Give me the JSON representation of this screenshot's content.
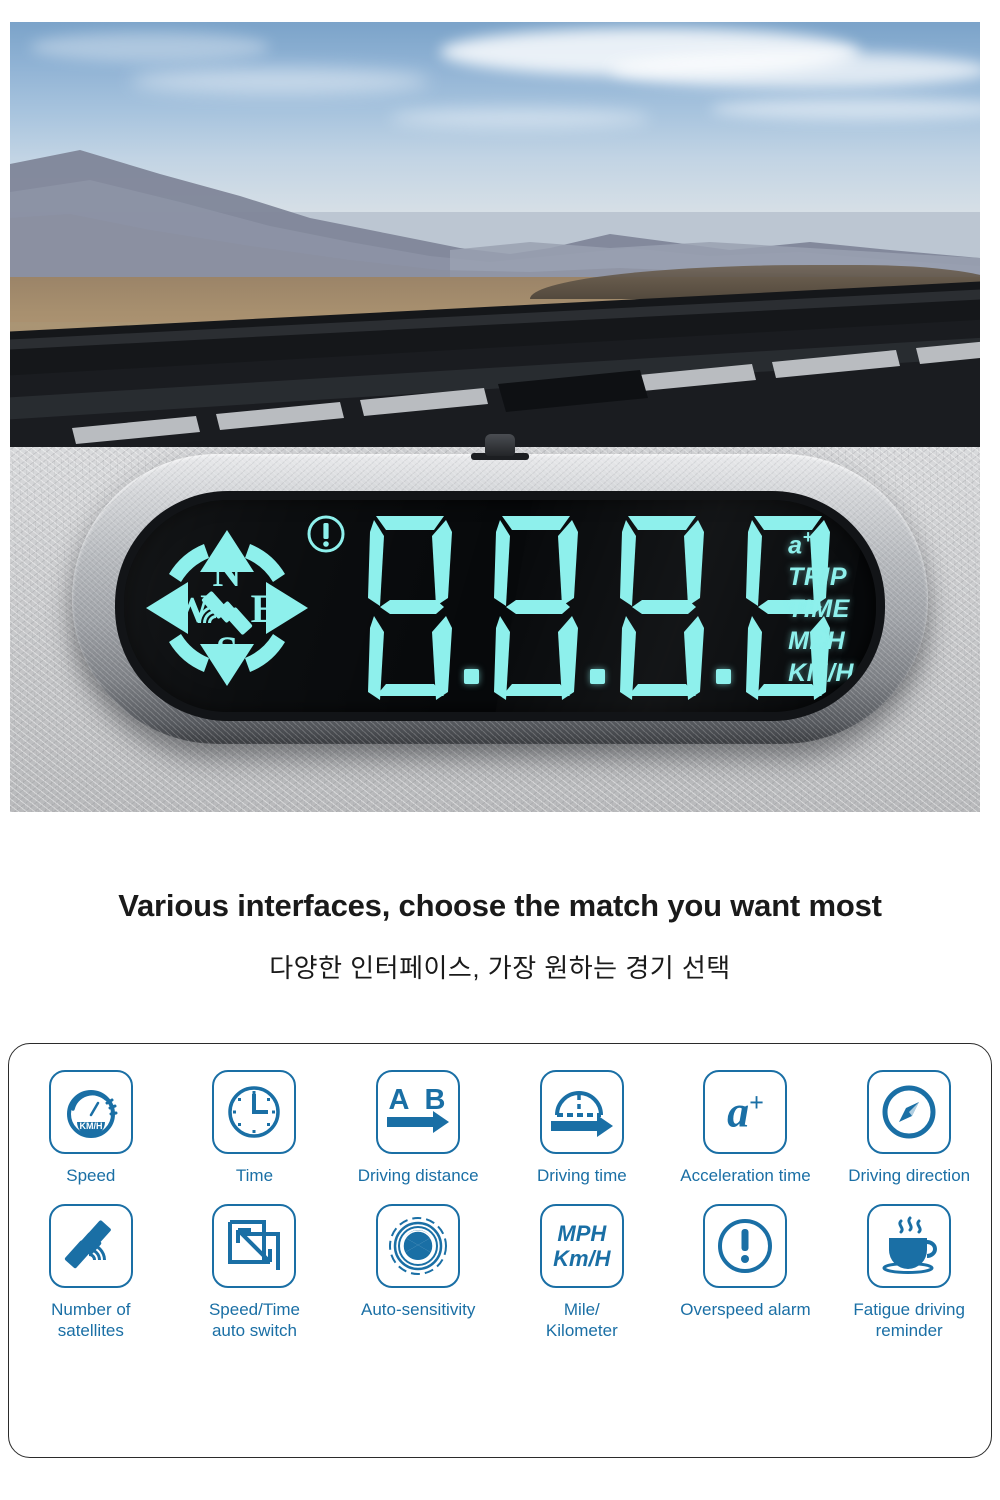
{
  "hero": {
    "scene_description": "Desert highway viewed through car windshield with HUD device on dashboard",
    "device": {
      "display": {
        "digits": [
          "8",
          "8",
          "8",
          "8"
        ],
        "separator": ".",
        "compass": {
          "north": "N",
          "west": "W",
          "east": "E",
          "south": "S",
          "center_icon": "satellite-icon"
        },
        "warning_icon": "exclamation-circle-icon",
        "units": [
          {
            "id": "accel",
            "label": "a",
            "sup": "+"
          },
          {
            "id": "trip",
            "label": "TRIP"
          },
          {
            "id": "time",
            "label": "TIME"
          },
          {
            "id": "mph",
            "label": "MPH"
          },
          {
            "id": "kmh",
            "label": "KM/H"
          }
        ]
      }
    }
  },
  "headings": {
    "title": "Various interfaces, choose the match you want most",
    "subtitle": "다양한 인터페이스, 가장 원하는 경기 선택"
  },
  "features": [
    {
      "icon": "speedometer-icon",
      "label": "Speed",
      "inner_text": "KM/H"
    },
    {
      "icon": "clock-icon",
      "label": "Time"
    },
    {
      "icon": "a-to-b-arrow-icon",
      "label": "Driving distance",
      "inner_text": "A B"
    },
    {
      "icon": "gauge-arrow-icon",
      "label": "Driving time"
    },
    {
      "icon": "acceleration-icon",
      "label": "Acceleration time",
      "inner_text": "a",
      "inner_sup": "+"
    },
    {
      "icon": "compass-icon",
      "label": "Driving direction"
    },
    {
      "icon": "satellite-icon",
      "label": "Number of\nsatellites"
    },
    {
      "icon": "resize-switch-icon",
      "label": "Speed/Time\nauto switch"
    },
    {
      "icon": "aperture-icon",
      "label": "Auto-sensitivity"
    },
    {
      "icon": "mph-kmh-icon",
      "label": "Mile/\nKilometer",
      "inner_line1": "MPH",
      "inner_line2": "Km/H"
    },
    {
      "icon": "exclamation-circle-icon",
      "label": "Overspeed alarm"
    },
    {
      "icon": "coffee-cup-icon",
      "label": "Fatigue driving\nreminder"
    }
  ],
  "colors": {
    "accent_blue": "#1a6fa5",
    "display_cyan": "#8ef0ec",
    "panel_border": "#2b2b2b",
    "heading_text": "#1a1a1a"
  }
}
